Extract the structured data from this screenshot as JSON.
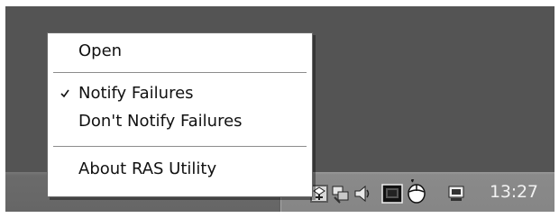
{
  "context_menu": {
    "items": [
      {
        "label": "Open"
      },
      {
        "label": "Notify Failures",
        "checked": true
      },
      {
        "label": "Don't Notify Failures"
      },
      {
        "label": "About RAS Utility"
      }
    ]
  },
  "tray": {
    "icons": [
      "network-icon",
      "connection-icon",
      "speaker-icon",
      "monitor-icon",
      "mouse-icon",
      "computer-icon"
    ],
    "clock": "13:27"
  }
}
